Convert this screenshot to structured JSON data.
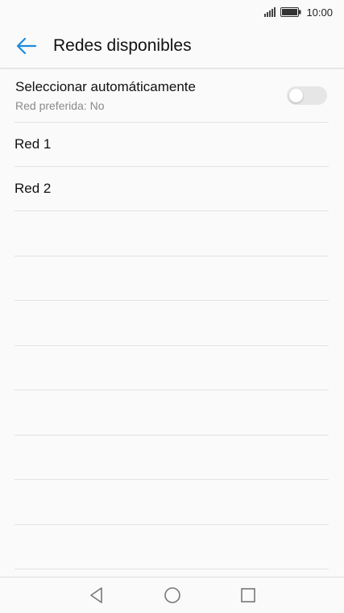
{
  "status_bar": {
    "time": "10:00",
    "icons": [
      "signal-icon",
      "battery-icon"
    ]
  },
  "app_bar": {
    "back_icon": "arrow-left-icon",
    "title": "Redes disponibles"
  },
  "auto_select": {
    "title": "Seleccionar automáticamente",
    "subtitle": "Red preferida: No",
    "enabled": false
  },
  "networks": [
    {
      "label": "Red 1"
    },
    {
      "label": "Red 2"
    }
  ],
  "nav_bar": {
    "icons": [
      "back-triangle-icon",
      "home-circle-icon",
      "recents-square-icon"
    ]
  },
  "colors": {
    "accent": "#1a8ce0",
    "background": "#fafafa",
    "divider": "#e3e3e3",
    "switch_off": "#e6e6e6"
  }
}
